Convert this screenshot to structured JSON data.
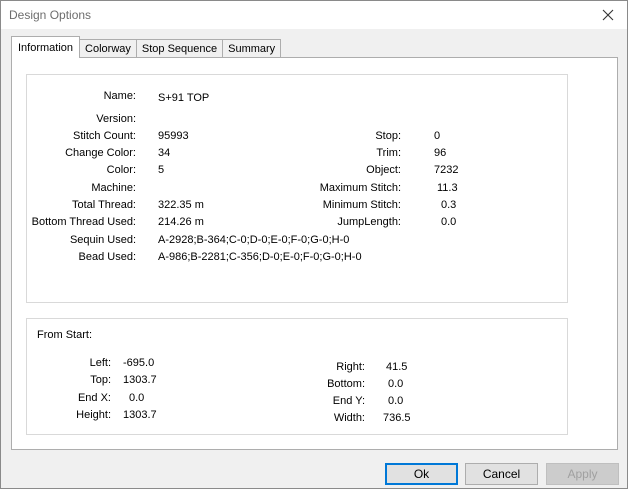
{
  "window": {
    "title": "Design Options"
  },
  "tabs": [
    {
      "label": "Information",
      "active": true
    },
    {
      "label": "Colorway",
      "active": false
    },
    {
      "label": "Stop Sequence",
      "active": false
    },
    {
      "label": "Summary",
      "active": false
    }
  ],
  "info": {
    "name_label": "Name:",
    "name_value": "S+91 TOP",
    "version_label": "Version:",
    "version_value": "",
    "stitch_count_label": "Stitch Count:",
    "stitch_count_value": "95993",
    "change_color_label": "Change Color:",
    "change_color_value": "34",
    "color_label": "Color:",
    "color_value": "5",
    "machine_label": "Machine:",
    "machine_value": "",
    "total_thread_label": "Total Thread:",
    "total_thread_value": "322.35 m",
    "bottom_thread_label": "Bottom Thread Used:",
    "bottom_thread_value": "214.26 m",
    "sequin_label": "Sequin Used:",
    "sequin_value": "A-2928;B-364;C-0;D-0;E-0;F-0;G-0;H-0",
    "bead_label": "Bead Used:",
    "bead_value": "A-986;B-2281;C-356;D-0;E-0;F-0;G-0;H-0",
    "stop_label": "Stop:",
    "stop_value": "0",
    "trim_label": "Trim:",
    "trim_value": "96",
    "object_label": "Object:",
    "object_value": "7232",
    "max_stitch_label": "Maximum Stitch:",
    "max_stitch_value": "11.3",
    "min_stitch_label": "Minimum Stitch:",
    "min_stitch_value": "0.3",
    "jump_length_label": "JumpLength:",
    "jump_length_value": "0.0"
  },
  "from_start": {
    "heading": "From Start:",
    "left_label": "Left:",
    "left_value": "-695.0",
    "top_label": "Top:",
    "top_value": "1303.7",
    "end_x_label": "End X:",
    "end_x_value": "0.0",
    "height_label": "Height:",
    "height_value": "1303.7",
    "right_label": "Right:",
    "right_value": "41.5",
    "bottom_label": "Bottom:",
    "bottom_value": "0.0",
    "end_y_label": "End Y:",
    "end_y_value": "0.0",
    "width_label": "Width:",
    "width_value": "736.5"
  },
  "buttons": {
    "ok": "Ok",
    "cancel": "Cancel",
    "apply": "Apply"
  }
}
